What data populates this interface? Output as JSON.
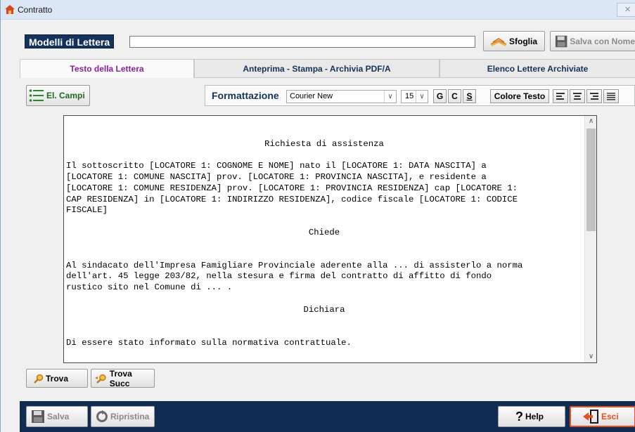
{
  "window": {
    "title": "Contratto",
    "close_glyph": "✕"
  },
  "header": {
    "modelli_label": "Modelli di Lettera",
    "model_value": "",
    "sfoglia_label": "Sfoglia",
    "salva_nome_label": "Salva con Nome"
  },
  "tabs": [
    {
      "label": "Testo della Lettera",
      "active": true
    },
    {
      "label": "Anteprima - Stampa - Archivia PDF/A",
      "active": false
    },
    {
      "label": "Elenco Lettere Archiviate",
      "active": false
    }
  ],
  "toolbar": {
    "el_campi_label": "El. Campi",
    "formatting_label": "Formattazione",
    "font_value": "Courier New",
    "size_value": "15",
    "bold_label": "G",
    "italic_label": "C",
    "underline_label": "S",
    "color_label": "Colore Testo",
    "align_icons": [
      "align-left-icon",
      "align-center-icon",
      "align-right-icon",
      "justify-icon"
    ]
  },
  "document": {
    "heading1": "Richiesta di assistenza",
    "para1": [
      "Il sottoscritto [LOCATORE 1: COGNOME E NOME] nato il [LOCATORE 1: DATA NASCITA] a",
      "[LOCATORE 1: COMUNE NASCITA] prov. [LOCATORE 1: PROVINCIA NASCITA], e residente a",
      "[LOCATORE 1: COMUNE RESIDENZA] prov. [LOCATORE 1: PROVINCIA RESIDENZA] cap [LOCATORE 1:",
      "CAP RESIDENZA] in [LOCATORE 1: INDIRIZZO RESIDENZA], codice fiscale [LOCATORE 1: CODICE",
      "FISCALE]"
    ],
    "heading2": "Chiede",
    "para2": [
      "Al sindacato dell'Impresa Famigliare Provinciale aderente alla ... di assisterlo a norma",
      "dell'art. 45 legge 203/82, nella stesura e firma del contratto di affitto di fondo",
      "rustico sito nel Comune di ... ."
    ],
    "heading3": "Dichiara",
    "para3": "Di essere stato informato sulla normativa contrattuale."
  },
  "search": {
    "trova_label": "Trova",
    "trova_succ_label": "Trova Succ"
  },
  "footer": {
    "salva_label": "Salva",
    "ripristina_label": "Ripristina",
    "help_label": "Help",
    "esci_label": "Esci"
  },
  "colors": {
    "navy": "#112c52",
    "tab_active_text": "#8b1f9c",
    "exit_accent": "#e8501a"
  }
}
